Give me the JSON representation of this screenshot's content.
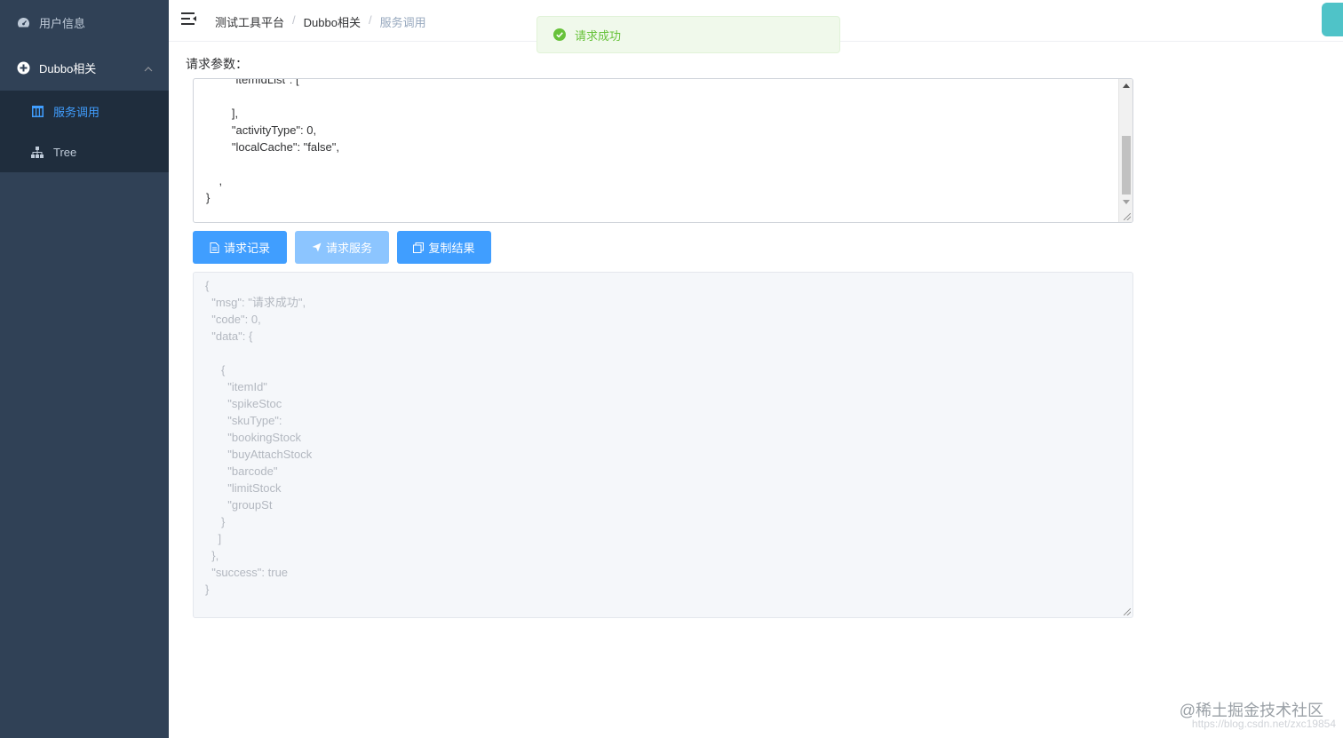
{
  "sidebar": {
    "items": [
      {
        "label": "用户信息",
        "icon": "dashboard-icon"
      },
      {
        "label": "Dubbo相关",
        "icon": "circle-plus-icon",
        "expanded": true,
        "children": [
          {
            "label": "服务调用",
            "icon": "table-icon",
            "active": true
          },
          {
            "label": "Tree",
            "icon": "tree-icon"
          }
        ]
      }
    ]
  },
  "navbar": {
    "breadcrumb": [
      "测试工具平台",
      "Dubbo相关",
      "服务调用"
    ]
  },
  "toast": {
    "message": "请求成功"
  },
  "form": {
    "param_label": "请求参数：",
    "request_text": "        \"itemIdList\": [\n            \n        ],\n        \"activityType\": 0,\n        \"localCache\": \"false\",\n        \n    ,\n}",
    "response_text": "{\n  \"msg\": \"请求成功\",\n  \"code\": 0,\n  \"data\": {\n    \n     {\n       \"itemId\"\n       \"spikeStoc\n       \"skuType\": \n       \"bookingStock\n       \"buyAttachStock\n       \"barcode\"\n       \"limitStock\n       \"groupSt\n     }\n    ]\n  },\n  \"success\": true\n}"
  },
  "buttons": {
    "record": "请求记录",
    "request": "请求服务",
    "copy": "复制结果"
  },
  "watermark": {
    "brand": "@稀土掘金技术社区",
    "url": "https://blog.csdn.net/zxc19854"
  },
  "colors": {
    "sidebar_bg": "#304156",
    "submenu_bg": "#1f2d3d",
    "primary": "#409eff",
    "success": "#67c23a"
  }
}
